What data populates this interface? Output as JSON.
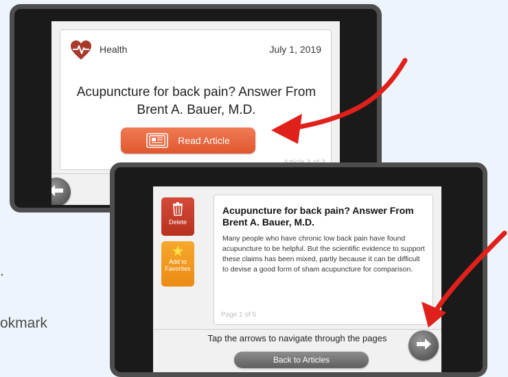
{
  "background": {
    "text_fragments": [
      ".",
      "okmark"
    ]
  },
  "article_screen": {
    "category": "Health",
    "date": "July 1, 2019",
    "title": "Acupuncture for back pain? Answer From Brent A. Bauer, M.D.",
    "read_button_label": "Read Article",
    "counter": "Article 3 of 3"
  },
  "reader_screen": {
    "delete_label": "Delete",
    "favorites_label": "Add to Favorites",
    "title": "Acupuncture for back pain? Answer From Brent A. Bauer, M.D.",
    "body": "Many people who have chronic low back pain have found acupuncture to be helpful. But the scientific evidence to support these claims has been mixed, partly because it can be difficult to devise a good form of sham acupuncture for comparison.",
    "page_indicator": "Page 1 of 5",
    "instruction": "Tap the arrows to navigate through the pages",
    "back_button_label": "Back to Articles"
  },
  "colors": {
    "accent_orange": "#e8613c",
    "heart_red": "#a83a2a",
    "delete_red": "#c43b2c",
    "favorites_orange": "#f29a20",
    "pointer_red": "#e0201a"
  },
  "icons": [
    "heart-pulse-icon",
    "newspaper-icon",
    "trash-icon",
    "star-icon",
    "arrow-left-icon",
    "arrow-right-icon"
  ]
}
